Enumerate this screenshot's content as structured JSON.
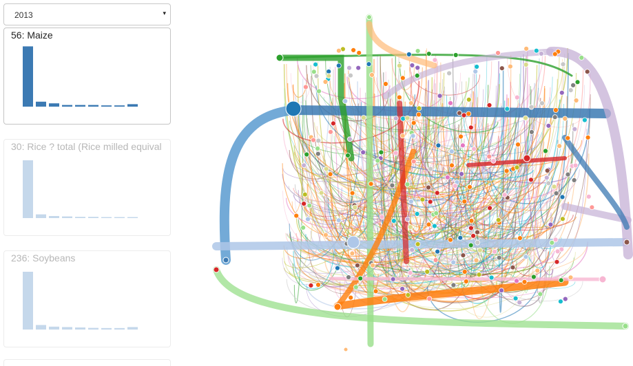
{
  "year_select": {
    "value": "2013",
    "caret": "▾"
  },
  "cards": [
    {
      "title": "56: Maize",
      "active": true,
      "bars": [
        0.73,
        0.06,
        0.04,
        0.02,
        0.02,
        0.02,
        0.015,
        0.015,
        0.03
      ]
    },
    {
      "title": "30: Rice ? total (Rice milled equival",
      "active": false,
      "bars": [
        0.7,
        0.045,
        0.025,
        0.02,
        0.015,
        0.015,
        0.012,
        0.012,
        0.012
      ]
    },
    {
      "title": "236: Soybeans",
      "active": false,
      "bars": [
        0.7,
        0.055,
        0.035,
        0.03,
        0.025,
        0.02,
        0.018,
        0.018,
        0.03
      ]
    }
  ],
  "colors": {
    "bar_active": "#3c7ab3",
    "bar_inactive": "#c5d8eb",
    "palette": [
      "#ff7f0e",
      "#ff7f0e",
      "#ff7f0e",
      "#1f77b4",
      "#aec7e8",
      "#2ca02c",
      "#98df8a",
      "#d62728",
      "#ff9896",
      "#9467bd",
      "#c5b0d5",
      "#8c564b",
      "#e377c2",
      "#f7b6d2",
      "#7f7f7f",
      "#c7c7c7",
      "#bcbd22",
      "#dbdb8d",
      "#17becf",
      "#ffbb78"
    ]
  }
}
